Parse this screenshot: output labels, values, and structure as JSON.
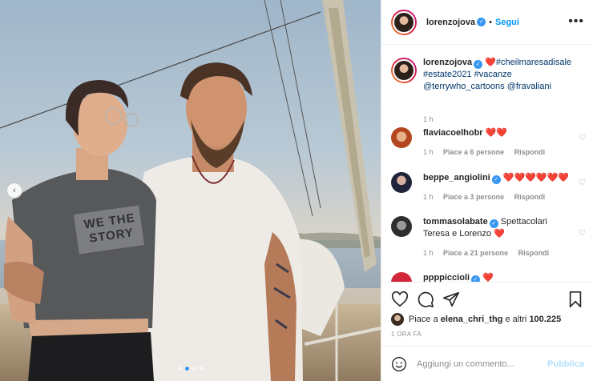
{
  "header": {
    "username": "lorenzojova",
    "separator": "•",
    "follow_label": "Segui",
    "more_icon": "more-horizontal-icon"
  },
  "caption": {
    "username": "lorenzojova",
    "heart": "❤️",
    "tags_line1": "#cheilmaresadisale",
    "tags_line2": "#estate2021 #vacanze",
    "tags_line3": "@terrywho_cartoons @fravaliani",
    "time": "1 h"
  },
  "comments": [
    {
      "username": "flaviacoelhobr",
      "text": "❤️❤️",
      "time": "1 h",
      "likes": "Piace a 6 persone",
      "reply": "Rispondi",
      "verified": false
    },
    {
      "username": "beppe_angiolini",
      "text": "❤️❤️❤️❤️❤️❤️",
      "time": "1 h",
      "likes": "Piace a 3 persone",
      "reply": "Rispondi",
      "verified": true
    },
    {
      "username": "tommasolabate",
      "text": "Spettacolari",
      "text2": "Teresa e Lorenzo ❤️",
      "time": "1 h",
      "likes": "Piace a 21 persone",
      "reply": "Rispondi",
      "verified": true
    },
    {
      "username": "ppppiccioli",
      "text": "❤️",
      "verified": true
    }
  ],
  "actions": {
    "like_icon": "heart-outline-icon",
    "comment_icon": "comment-icon",
    "share_icon": "paper-plane-icon",
    "save_icon": "bookmark-icon"
  },
  "likes": {
    "prefix": "Piace a",
    "user": "elena_chri_thg",
    "suffix": "e altri",
    "count": "100.225"
  },
  "timestamp": "1 ORA FA",
  "add_comment": {
    "placeholder": "Aggiungi un commento...",
    "publish_label": "Pubblica"
  },
  "photo": {
    "shirt_text": "WE THE STORY",
    "carousel_dots": 4,
    "active_dot": 1
  },
  "colors": {
    "accent": "#0095f6",
    "heart": "#ed4956",
    "verified": "#3897f0",
    "publish_disabled": "#b2dffc"
  }
}
